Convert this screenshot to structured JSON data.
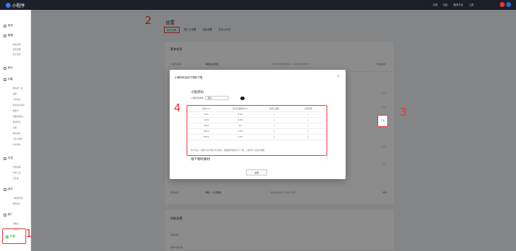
{
  "topbar": {
    "app_name": "小程序",
    "links": [
      "文档",
      "社区",
      "服务平台",
      "工具"
    ]
  },
  "sidebar": {
    "groups": [
      {
        "label": "首页",
        "subs": []
      },
      {
        "label": "管理",
        "subs": [
          "版本管理",
          "成员管理",
          "用户反馈"
        ]
      },
      {
        "label": "统计",
        "subs": []
      },
      {
        "label": "功能",
        "subs": [
          "微信搜一搜",
          "客服",
          "订阅消息",
          "附近的小程序",
          "视频号",
          "页面内容接入",
          "物流助手",
          "直播",
          "跨境电商",
          "门店小程序",
          "交易组件"
        ]
      },
      {
        "label": "开发",
        "subs": [
          "开发管理",
          "开发工具",
          "云开发"
        ]
      },
      {
        "label": "成长",
        "subs": [
          "小程序评测",
          "规则中心"
        ]
      },
      {
        "label": "推广",
        "subs": [
          "流量主",
          "广告主"
        ]
      }
    ],
    "active_label": "设置"
  },
  "page": {
    "title": "设置",
    "tabs": [
      "基本设置",
      "第三方设置",
      "消息设置",
      "关注公众号"
    ]
  },
  "basic_card": {
    "title": "基本信息",
    "rows": [
      {
        "label": "小程序名称",
        "value": "审核后可修改",
        "desc": "一年内可申请修改5次，本年还可修改5次",
        "link": "修改名称"
      },
      {
        "label": "",
        "value": "",
        "desc": "",
        "link": "修改"
      },
      {
        "label": "",
        "value": "",
        "desc": "",
        "link": "修改"
      },
      {
        "label": "",
        "value": "",
        "desc": "",
        "link": "下载"
      },
      {
        "label": "",
        "value": "",
        "desc": "",
        "link": "设置"
      },
      {
        "label": "",
        "value": "",
        "desc": "",
        "link": "设置"
      },
      {
        "label": "服务类目",
        "value": "服务 > 生活服务",
        "desc": "能够在此类目下发布小程序",
        "link": "详情"
      }
    ]
  },
  "func_card": {
    "title": "功能设置",
    "rows": [
      {
        "label": "基础设置",
        "value": "",
        "desc": "",
        "link": ""
      },
      {
        "label": "服务内容声明",
        "value": "",
        "desc": "",
        "link": ""
      }
    ]
  },
  "modal": {
    "title": "小程序码及线下物料下载",
    "section1": "小程序码",
    "size_label": "小程序码类型",
    "size_value": "默认",
    "table_headers": [
      "边长(cm)",
      "建议扫描距离(m)",
      "普通二维码",
      "小程序码"
    ],
    "table_rows": [
      [
        "8cm",
        "0.5m"
      ],
      [
        "12cm",
        "0.8m"
      ],
      [
        "15cm",
        "1m"
      ],
      [
        "30cm",
        "1.5m"
      ],
      [
        "50cm",
        "2.5m"
      ]
    ],
    "note": "每个码扫一下都可以在手机打开小程序，请根据所需要的尺寸下载，二维码尺寸请自行调整。",
    "section2": "线下物料素材",
    "close_button": "关闭"
  },
  "annotations": [
    "1",
    "2",
    "3",
    "4"
  ],
  "colors": {
    "annotation": "#ee3333",
    "accent": "#1aad19",
    "link": "#576b95"
  }
}
